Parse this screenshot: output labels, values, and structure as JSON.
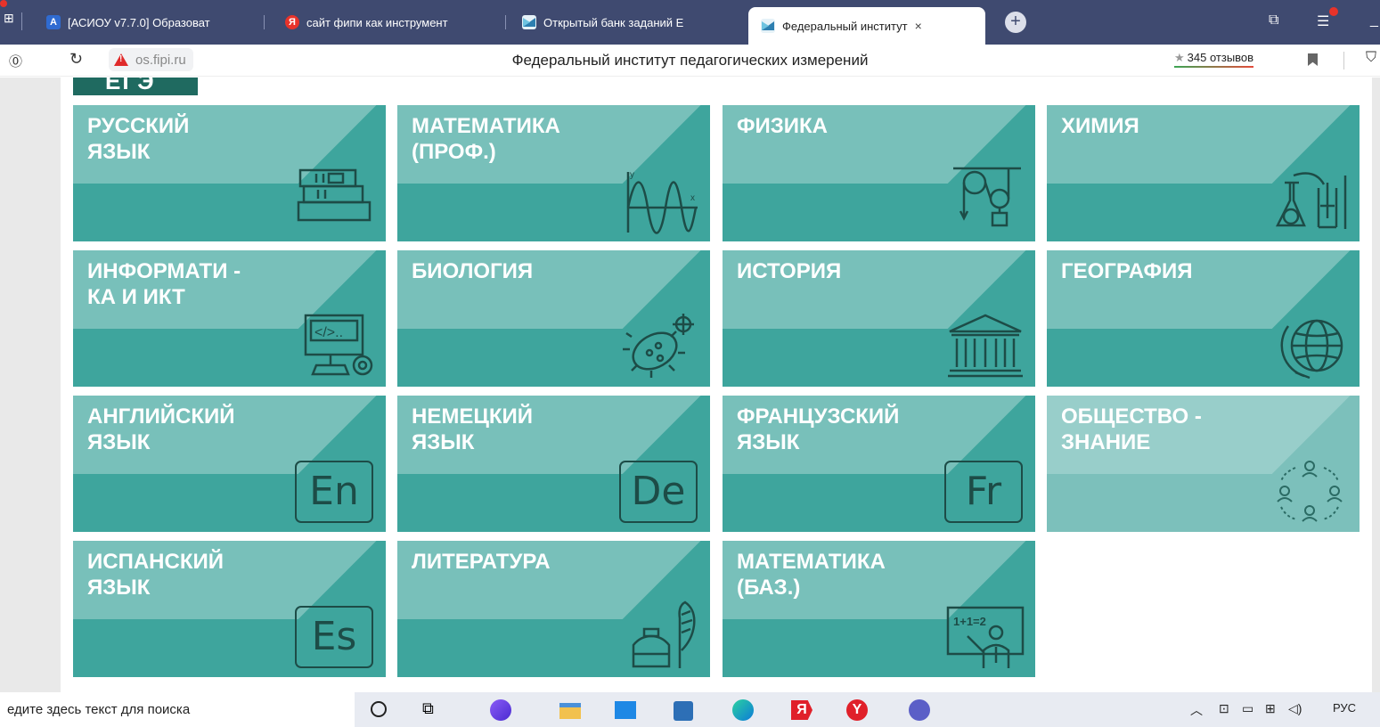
{
  "browser": {
    "tabs": [
      {
        "label": "[АСИОУ v7.7.0] Образоват",
        "icon": "asiou-favicon",
        "color": "#2f6bd1",
        "glyph": "A"
      },
      {
        "label": "сайт фипи как инструмент",
        "icon": "yandex-favicon",
        "color": "#e8332a",
        "glyph": "Я"
      },
      {
        "label": "Открытый банк заданий Е",
        "icon": "fipi-favicon",
        "color": "#4fa3c8",
        "glyph": ""
      },
      {
        "label": "Федеральный институт",
        "icon": "fipi-favicon",
        "color": "#4fa3c8",
        "glyph": "",
        "active": true
      }
    ],
    "close_glyph": "×",
    "newtab_glyph": "+",
    "address": {
      "domain": "os.fipi.ru",
      "page_title": "Федеральный институт педагогических измерений",
      "reviews": "345 отзывов",
      "star": "★"
    }
  },
  "page": {
    "ege_tag": "ЕГЭ",
    "subjects": [
      {
        "title": "Русский\nязык",
        "icon": "books-icon"
      },
      {
        "title": "Математика\n(проф.)",
        "icon": "graph-icon"
      },
      {
        "title": "Физика",
        "icon": "pulley-icon"
      },
      {
        "title": "Химия",
        "icon": "flask-icon"
      },
      {
        "title": "Информати -\nка и ИКТ",
        "icon": "computer-icon"
      },
      {
        "title": "Биология",
        "icon": "bacteria-icon"
      },
      {
        "title": "История",
        "icon": "temple-icon"
      },
      {
        "title": "География",
        "icon": "globe-icon"
      },
      {
        "title": "Английский\nязык",
        "icon": "lang-icon",
        "lang": "En"
      },
      {
        "title": "Немецкий\nязык",
        "icon": "lang-icon",
        "lang": "De"
      },
      {
        "title": "Французский\nязык",
        "icon": "lang-icon",
        "lang": "Fr"
      },
      {
        "title": "Обществознание",
        "display": "Общество -\nзнание",
        "icon": "people-icon"
      },
      {
        "title": "Испанский\nязык",
        "icon": "lang-icon",
        "lang": "Es"
      },
      {
        "title": "Литература",
        "icon": "inkpen-icon"
      },
      {
        "title": "Математика\n(баз.)",
        "icon": "teacher-icon"
      }
    ],
    "tile_color": "#3ea59d",
    "tile_color_light": "#7cc0bb"
  },
  "taskbar": {
    "search_placeholder": "едите здесь текст для поиска",
    "lang": "РУС"
  }
}
